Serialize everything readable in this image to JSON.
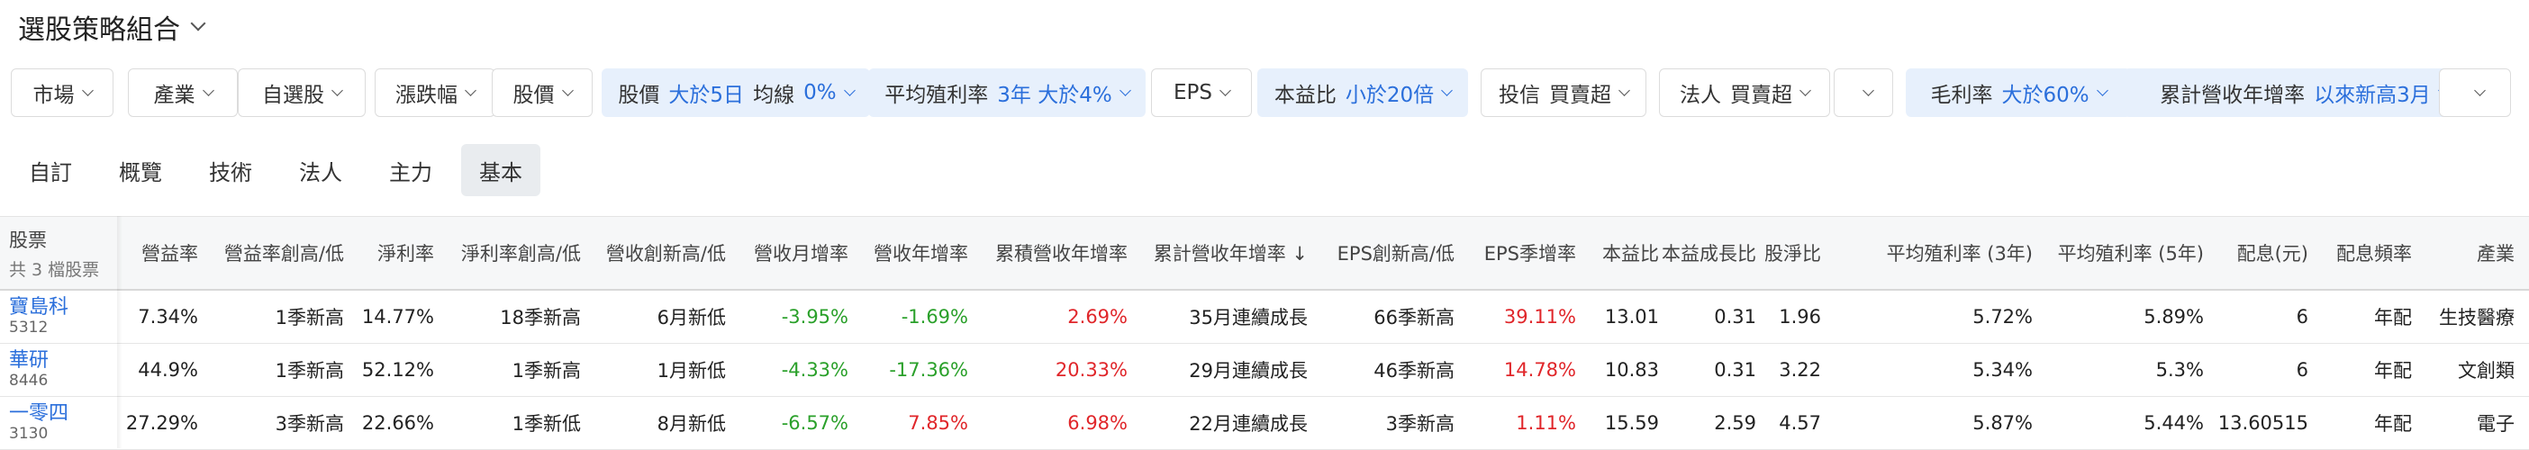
{
  "page": {
    "title": "選股策略組合"
  },
  "filters": [
    {
      "label": "市場",
      "value": "",
      "active": false
    },
    {
      "label": "產業",
      "value": "",
      "active": false
    },
    {
      "label": "自選股",
      "value": "",
      "active": false
    },
    {
      "label": "漲跌幅",
      "value": "",
      "active": false
    },
    {
      "label": "股價",
      "value": "",
      "active": false
    },
    {
      "label": "股價",
      "value": "大於5日",
      "label2": "均線",
      "value2": "0%",
      "active": true
    },
    {
      "label": "平均殖利率",
      "value": "3年 大於4%",
      "active": true
    },
    {
      "label": "EPS",
      "value": "",
      "active": false
    },
    {
      "label": "本益比",
      "value": "小於20倍",
      "active": true
    },
    {
      "label": "投信",
      "value": "",
      "label2": "買賣超",
      "active": false
    },
    {
      "label": "法人",
      "value": "",
      "label2": "買賣超",
      "active": false
    },
    {
      "label": "",
      "value": "",
      "active": false
    },
    {
      "label": "毛利率",
      "value": "大於60%",
      "active": true
    },
    {
      "label": "累計營收年增率",
      "value": "以來新高3月",
      "active": true
    },
    {
      "label": "",
      "value": "",
      "active": false
    }
  ],
  "tabs": [
    {
      "label": "自訂",
      "active": false
    },
    {
      "label": "概覽",
      "active": false
    },
    {
      "label": "技術",
      "active": false
    },
    {
      "label": "法人",
      "active": false
    },
    {
      "label": "主力",
      "active": false
    },
    {
      "label": "基本",
      "active": true
    }
  ],
  "table": {
    "first_header": "股票",
    "first_sub": "共 3 檔股票",
    "headers": [
      "營益率",
      "營益率創高/低",
      "淨利率",
      "淨利率創高/低",
      "營收創新高/低",
      "營收月增率",
      "營收年增率",
      "累積營收年增率",
      "累計營收年增率 ↓",
      "EPS創新高/低",
      "EPS季增率",
      "本益比",
      "本益成長比",
      "股淨比",
      "平均殖利率 (3年)",
      "平均殖利率 (5年)",
      "配息(元)",
      "配息頻率",
      "產業"
    ],
    "rows": [
      {
        "name": "寶島科",
        "code": "5312",
        "cells": [
          "7.34%",
          "1季新高",
          "14.77%",
          "18季新高",
          "6月新低",
          "-3.95%",
          "-1.69%",
          "2.69%",
          "35月連續成長",
          "66季新高",
          "39.11%",
          "13.01",
          "0.31",
          "1.96",
          "5.72%",
          "5.89%",
          "6",
          "年配",
          "生技醫療"
        ],
        "colors": [
          "",
          "",
          "",
          "",
          "",
          "green",
          "green",
          "red",
          "",
          "",
          "red",
          "",
          "",
          "",
          "",
          "",
          "",
          "",
          ""
        ]
      },
      {
        "name": "華研",
        "code": "8446",
        "cells": [
          "44.9%",
          "1季新高",
          "52.12%",
          "1季新高",
          "1月新低",
          "-4.33%",
          "-17.36%",
          "20.33%",
          "29月連續成長",
          "46季新高",
          "14.78%",
          "10.83",
          "0.31",
          "3.22",
          "5.34%",
          "5.3%",
          "6",
          "年配",
          "文創類"
        ],
        "colors": [
          "",
          "",
          "",
          "",
          "",
          "green",
          "green",
          "red",
          "",
          "",
          "red",
          "",
          "",
          "",
          "",
          "",
          "",
          "",
          ""
        ]
      },
      {
        "name": "一零四",
        "code": "3130",
        "cells": [
          "27.29%",
          "3季新高",
          "22.66%",
          "1季新低",
          "8月新低",
          "-6.57%",
          "7.85%",
          "6.98%",
          "22月連續成長",
          "3季新高",
          "1.11%",
          "15.59",
          "2.59",
          "4.57",
          "5.87%",
          "5.44%",
          "13.60515",
          "年配",
          "電子"
        ],
        "colors": [
          "",
          "",
          "",
          "",
          "",
          "green",
          "red",
          "red",
          "",
          "",
          "red",
          "",
          "",
          "",
          "",
          "",
          "",
          "",
          ""
        ]
      }
    ]
  },
  "colors": {
    "accent": "#2b6fdb",
    "up": "#e0262a",
    "down": "#2aa02a",
    "active_chip_bg": "#e7f0fc"
  }
}
